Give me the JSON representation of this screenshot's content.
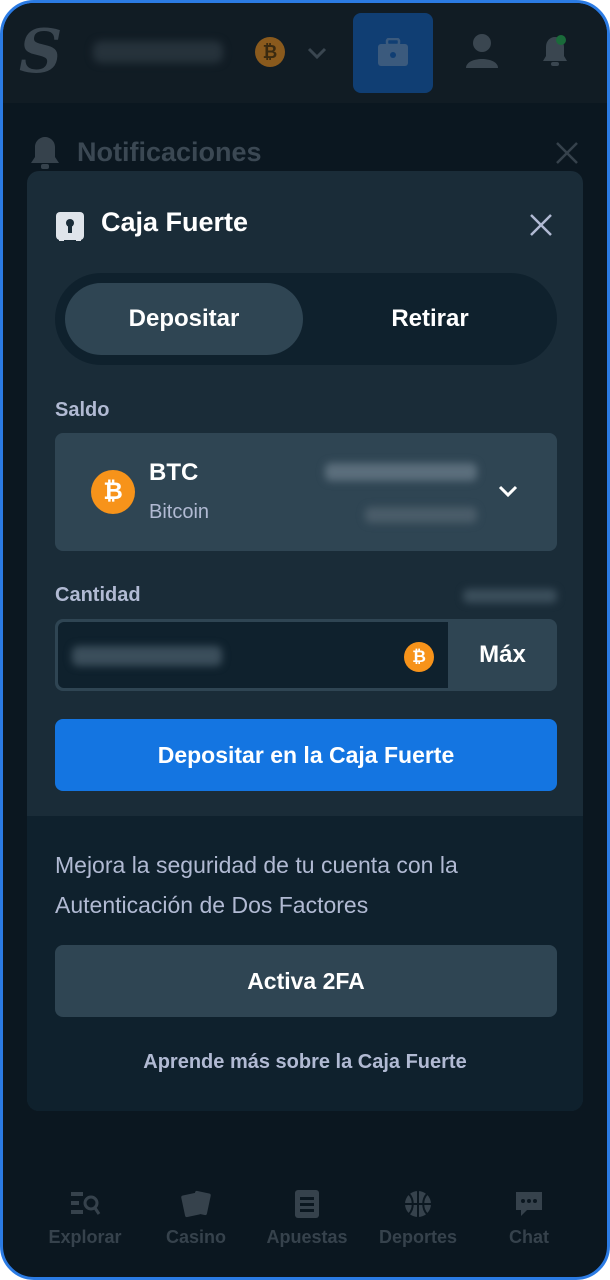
{
  "background": {
    "notifications_title": "Notificaciones",
    "nav": [
      {
        "label": "Explorar",
        "icon": "browse-icon"
      },
      {
        "label": "Casino",
        "icon": "cards-icon"
      },
      {
        "label": "Apuestas",
        "icon": "betslip-icon"
      },
      {
        "label": "Deportes",
        "icon": "basketball-icon"
      },
      {
        "label": "Chat",
        "icon": "chat-icon"
      }
    ]
  },
  "modal": {
    "title": "Caja Fuerte",
    "tabs": [
      {
        "label": "Depositar",
        "active": true
      },
      {
        "label": "Retirar",
        "active": false
      }
    ],
    "balance_label": "Saldo",
    "currency": {
      "code": "BTC",
      "name": "Bitcoin",
      "symbol": "₿"
    },
    "amount_label": "Cantidad",
    "max_label": "Máx",
    "deposit_button": "Depositar en la Caja Fuerte",
    "security_text": "Mejora la seguridad de tu cuenta con la Autenticación de Dos Factores",
    "twofa_button": "Activa 2FA",
    "learn_more": "Aprende más sobre la Caja Fuerte"
  },
  "colors": {
    "accent": "#1475e1",
    "bitcoin": "#f7931a",
    "panel": "#1a2c38",
    "input": "#2f4553"
  }
}
